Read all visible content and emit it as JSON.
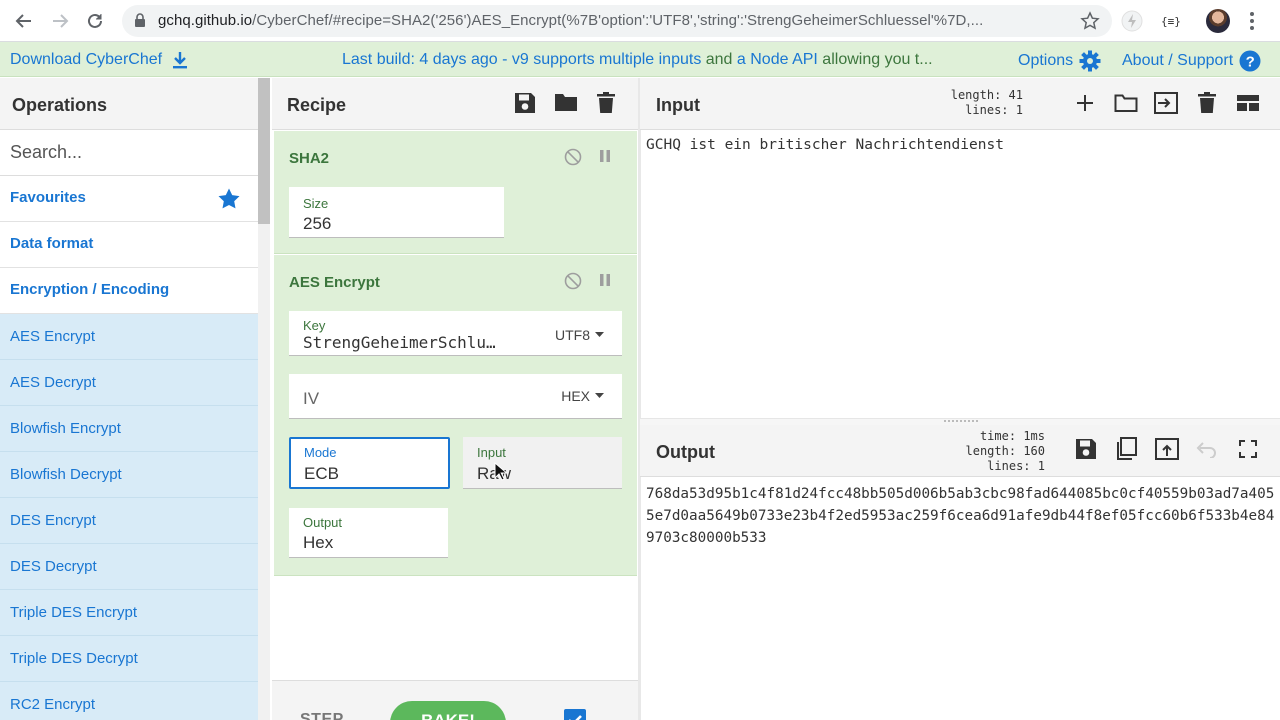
{
  "browser": {
    "url_host": "gchq.github.io",
    "url_path": "/CyberChef/#recipe=SHA2('256')AES_Encrypt(%7B'option':'UTF8','string':'StrengGeheimerSchluessel'%7D,..."
  },
  "banner": {
    "download_label": "Download CyberChef",
    "notice_a": "Last build: 4 days ago - v9 supports multiple inputs",
    "notice_and": " and ",
    "notice_b": "a Node API",
    "notice_c": " allowing you t...",
    "options_label": "Options",
    "about_label": "About / Support"
  },
  "operations": {
    "title": "Operations",
    "search_placeholder": "Search...",
    "categories": [
      "Favourites",
      "Data format",
      "Encryption / Encoding"
    ],
    "items": [
      "AES Encrypt",
      "AES Decrypt",
      "Blowfish Encrypt",
      "Blowfish Decrypt",
      "DES Encrypt",
      "DES Decrypt",
      "Triple DES Encrypt",
      "Triple DES Decrypt",
      "RC2 Encrypt"
    ]
  },
  "recipe": {
    "title": "Recipe",
    "sha2": {
      "name": "SHA2",
      "size_label": "Size",
      "size_value": "256"
    },
    "aes": {
      "name": "AES Encrypt",
      "key_label": "Key",
      "key_value": "StrengGeheimerSchlu…",
      "key_format": "UTF8",
      "iv_label": "IV",
      "iv_format": "HEX",
      "mode_label": "Mode",
      "mode_value": "ECB",
      "input_label": "Input",
      "input_value": "Raw",
      "output_label": "Output",
      "output_value": "Hex"
    },
    "step_label": "STEP",
    "bake_label": "BAKE!"
  },
  "input": {
    "title": "Input",
    "length_label": "length:",
    "length_value": "41",
    "lines_label": "lines:",
    "lines_value": "1",
    "text": "GCHQ ist ein britischer Nachrichtendienst"
  },
  "output": {
    "title": "Output",
    "time_label": "time:",
    "time_value": "1ms",
    "length_label": "length:",
    "length_value": "160",
    "lines_label": "lines:",
    "lines_value": "1",
    "text": "768da53d95b1c4f81d24fcc48bb505d006b5ab3cbc98fad644085bc0cf40559b03ad7a4055e7d0aa5649b0733e23b4f2ed5953ac259f6cea6d91afe9db44f8ef05fcc60b6f533b4e849703c80000b533"
  },
  "colors": {
    "accent": "#1976d2",
    "recipe_bg": "#dff0d8",
    "op_bg": "#d8ebf7",
    "op_title": "#3c763d"
  }
}
